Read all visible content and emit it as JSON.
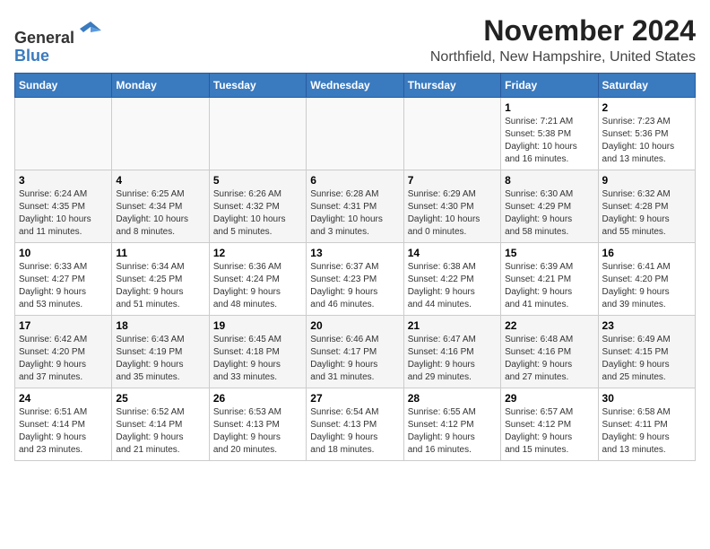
{
  "header": {
    "logo_line1": "General",
    "logo_line2": "Blue",
    "title": "November 2024",
    "subtitle": "Northfield, New Hampshire, United States"
  },
  "days_of_week": [
    "Sunday",
    "Monday",
    "Tuesday",
    "Wednesday",
    "Thursday",
    "Friday",
    "Saturday"
  ],
  "weeks": [
    [
      {
        "day": "",
        "detail": ""
      },
      {
        "day": "",
        "detail": ""
      },
      {
        "day": "",
        "detail": ""
      },
      {
        "day": "",
        "detail": ""
      },
      {
        "day": "",
        "detail": ""
      },
      {
        "day": "1",
        "detail": "Sunrise: 7:21 AM\nSunset: 5:38 PM\nDaylight: 10 hours\nand 16 minutes."
      },
      {
        "day": "2",
        "detail": "Sunrise: 7:23 AM\nSunset: 5:36 PM\nDaylight: 10 hours\nand 13 minutes."
      }
    ],
    [
      {
        "day": "3",
        "detail": "Sunrise: 6:24 AM\nSunset: 4:35 PM\nDaylight: 10 hours\nand 11 minutes."
      },
      {
        "day": "4",
        "detail": "Sunrise: 6:25 AM\nSunset: 4:34 PM\nDaylight: 10 hours\nand 8 minutes."
      },
      {
        "day": "5",
        "detail": "Sunrise: 6:26 AM\nSunset: 4:32 PM\nDaylight: 10 hours\nand 5 minutes."
      },
      {
        "day": "6",
        "detail": "Sunrise: 6:28 AM\nSunset: 4:31 PM\nDaylight: 10 hours\nand 3 minutes."
      },
      {
        "day": "7",
        "detail": "Sunrise: 6:29 AM\nSunset: 4:30 PM\nDaylight: 10 hours\nand 0 minutes."
      },
      {
        "day": "8",
        "detail": "Sunrise: 6:30 AM\nSunset: 4:29 PM\nDaylight: 9 hours\nand 58 minutes."
      },
      {
        "day": "9",
        "detail": "Sunrise: 6:32 AM\nSunset: 4:28 PM\nDaylight: 9 hours\nand 55 minutes."
      }
    ],
    [
      {
        "day": "10",
        "detail": "Sunrise: 6:33 AM\nSunset: 4:27 PM\nDaylight: 9 hours\nand 53 minutes."
      },
      {
        "day": "11",
        "detail": "Sunrise: 6:34 AM\nSunset: 4:25 PM\nDaylight: 9 hours\nand 51 minutes."
      },
      {
        "day": "12",
        "detail": "Sunrise: 6:36 AM\nSunset: 4:24 PM\nDaylight: 9 hours\nand 48 minutes."
      },
      {
        "day": "13",
        "detail": "Sunrise: 6:37 AM\nSunset: 4:23 PM\nDaylight: 9 hours\nand 46 minutes."
      },
      {
        "day": "14",
        "detail": "Sunrise: 6:38 AM\nSunset: 4:22 PM\nDaylight: 9 hours\nand 44 minutes."
      },
      {
        "day": "15",
        "detail": "Sunrise: 6:39 AM\nSunset: 4:21 PM\nDaylight: 9 hours\nand 41 minutes."
      },
      {
        "day": "16",
        "detail": "Sunrise: 6:41 AM\nSunset: 4:20 PM\nDaylight: 9 hours\nand 39 minutes."
      }
    ],
    [
      {
        "day": "17",
        "detail": "Sunrise: 6:42 AM\nSunset: 4:20 PM\nDaylight: 9 hours\nand 37 minutes."
      },
      {
        "day": "18",
        "detail": "Sunrise: 6:43 AM\nSunset: 4:19 PM\nDaylight: 9 hours\nand 35 minutes."
      },
      {
        "day": "19",
        "detail": "Sunrise: 6:45 AM\nSunset: 4:18 PM\nDaylight: 9 hours\nand 33 minutes."
      },
      {
        "day": "20",
        "detail": "Sunrise: 6:46 AM\nSunset: 4:17 PM\nDaylight: 9 hours\nand 31 minutes."
      },
      {
        "day": "21",
        "detail": "Sunrise: 6:47 AM\nSunset: 4:16 PM\nDaylight: 9 hours\nand 29 minutes."
      },
      {
        "day": "22",
        "detail": "Sunrise: 6:48 AM\nSunset: 4:16 PM\nDaylight: 9 hours\nand 27 minutes."
      },
      {
        "day": "23",
        "detail": "Sunrise: 6:49 AM\nSunset: 4:15 PM\nDaylight: 9 hours\nand 25 minutes."
      }
    ],
    [
      {
        "day": "24",
        "detail": "Sunrise: 6:51 AM\nSunset: 4:14 PM\nDaylight: 9 hours\nand 23 minutes."
      },
      {
        "day": "25",
        "detail": "Sunrise: 6:52 AM\nSunset: 4:14 PM\nDaylight: 9 hours\nand 21 minutes."
      },
      {
        "day": "26",
        "detail": "Sunrise: 6:53 AM\nSunset: 4:13 PM\nDaylight: 9 hours\nand 20 minutes."
      },
      {
        "day": "27",
        "detail": "Sunrise: 6:54 AM\nSunset: 4:13 PM\nDaylight: 9 hours\nand 18 minutes."
      },
      {
        "day": "28",
        "detail": "Sunrise: 6:55 AM\nSunset: 4:12 PM\nDaylight: 9 hours\nand 16 minutes."
      },
      {
        "day": "29",
        "detail": "Sunrise: 6:57 AM\nSunset: 4:12 PM\nDaylight: 9 hours\nand 15 minutes."
      },
      {
        "day": "30",
        "detail": "Sunrise: 6:58 AM\nSunset: 4:11 PM\nDaylight: 9 hours\nand 13 minutes."
      }
    ]
  ]
}
